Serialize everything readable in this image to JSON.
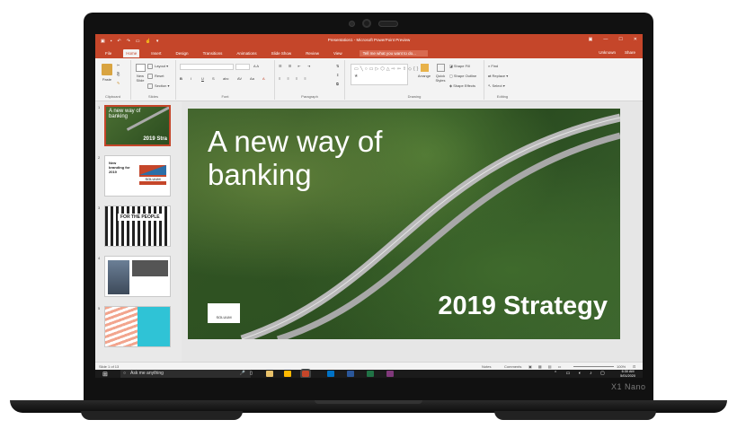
{
  "device": {
    "brand": "X1 Nano"
  },
  "app": {
    "window_title": "Presentation1 - Microsoft PowerPoint Preview",
    "tabs": [
      "File",
      "Home",
      "Insert",
      "Design",
      "Transitions",
      "Animations",
      "Slide Show",
      "Review",
      "View"
    ],
    "active_tab": "Home",
    "tell_me": "Tell me what you want to do...",
    "account": "Unknown",
    "share": "Share"
  },
  "ribbon": {
    "groups": [
      "Clipboard",
      "Slides",
      "Font",
      "Paragraph",
      "Drawing",
      "Editing"
    ],
    "paste": "Paste",
    "new_slide": "New Slide",
    "layout": "Layout",
    "reset": "Reset",
    "section": "Section",
    "arrange": "Arrange",
    "quick_styles": "Quick Styles",
    "shape_fill": "Shape Fill",
    "shape_outline": "Shape Outline",
    "shape_effects": "Shape Effects",
    "find": "Find",
    "replace": "Replace",
    "select": "Select"
  },
  "thumbnails": [
    {
      "num": "1",
      "title": "A new way of banking",
      "sub": "2019 Stra"
    },
    {
      "num": "2",
      "title": "New branding for 2019",
      "sub": "SOLUUM"
    },
    {
      "num": "3",
      "title": "FOR THE PEOPLE",
      "sub": ""
    },
    {
      "num": "4",
      "title": "",
      "sub": ""
    },
    {
      "num": "5",
      "title": "",
      "sub": ""
    }
  ],
  "slide": {
    "title": "A new way of banking",
    "subtitle": "2019 Strategy",
    "logo_text": "SOLUUM"
  },
  "status": {
    "slide_info": "Slide 1 of 13",
    "notes": "Notes",
    "comments": "Comments",
    "zoom": "100%"
  },
  "taskbar": {
    "search_placeholder": "Ask me anything",
    "time": "6:30 AM",
    "date": "5/01/2020"
  },
  "colors": {
    "accent": "#c5462a",
    "taskbar": "#1b1b1b"
  }
}
